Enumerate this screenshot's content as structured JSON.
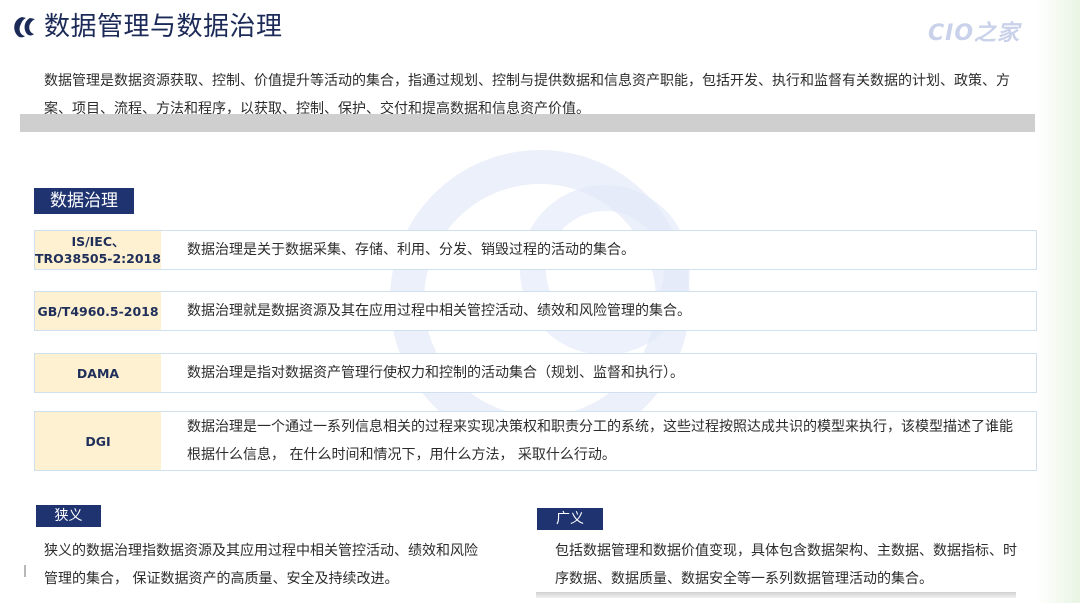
{
  "header": {
    "title": "数据管理与数据治理",
    "brand": "CIO之家"
  },
  "intro": "数据管理是数据资源获取、控制、价值提升等活动的集合，指通过规划、控制与提供数据和信息资产职能，包括开发、执行和监督有关数据的计划、政策、方案、项目、流程、方法和程序，以获取、控制、保护、交付和提高数据和信息资产价值。",
  "governance": {
    "tag": "数据治理",
    "definitions": [
      {
        "label": "IS/IEC、\nTRO38505-2:2018",
        "text": "数据治理是关于数据采集、存储、利用、分发、销毁过程的活动的集合。"
      },
      {
        "label": "GB/T4960.5-2018",
        "text": "数据治理就是数据资源及其在应用过程中相关管控活动、绩效和风险管理的集合。"
      },
      {
        "label": "DAMA",
        "text": "数据治理是指对数据资产管理行使权力和控制的活动集合（规划、监督和执行）。"
      },
      {
        "label": "DGI",
        "text": "数据治理是一个通过一系列信息相关的过程来实现决策权和职责分工的系统，这些过程按照达成共识的模型来执行，该模型描述了谁能根据什么信息， 在什么时间和情况下，用什么方法， 采取什么行动。"
      }
    ]
  },
  "narrow": {
    "tag": "狭义",
    "text": "狭义的数据治理指数据资源及其应用过程中相关管控活动、绩效和风险管理的集合， 保证数据资产的高质量、安全及持续改进。"
  },
  "broad": {
    "tag": "广义",
    "text": "包括数据管理和数据价值变现，具体包含数据架构、主数据、数据指标、时序数据、数据质量、数据安全等一系列数据管理活动的集合。"
  },
  "colors": {
    "navy": "#1f3370",
    "title": "#1b2a57",
    "label_bg": "#fdf1d2"
  }
}
